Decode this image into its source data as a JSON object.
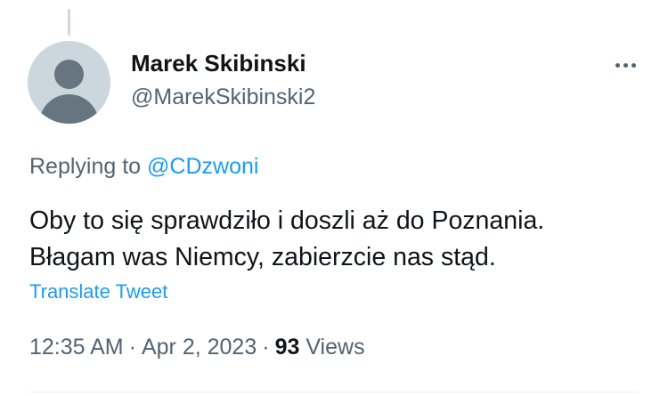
{
  "tweet": {
    "author": {
      "display_name": "Marek Skibinski",
      "handle": "@MarekSkibinski2",
      "avatar_icon": "default-profile-avatar-icon"
    },
    "more_icon": "more-horizontal-icon",
    "replying": {
      "prefix": "Replying to",
      "mention": "@CDzwoni"
    },
    "text_lines": [
      "Oby to się sprawdziło i doszli aż do Poznania.",
      "Błagam was Niemcy, zabierzcie nas stąd."
    ],
    "translate_label": "Translate Tweet",
    "meta": {
      "time": "12:35 AM",
      "separator": "·",
      "date": "Apr 2, 2023",
      "views_count": "93",
      "views_label": "Views"
    }
  },
  "colors": {
    "text_primary": "#0f1419",
    "text_secondary": "#536471",
    "link": "#1d9bf0",
    "avatar_bg": "#ccd6dd",
    "avatar_fg": "#66757f"
  }
}
